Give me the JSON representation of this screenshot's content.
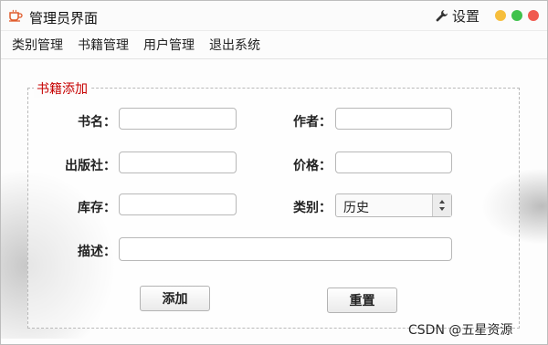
{
  "window": {
    "title": "管理员界面",
    "settings_label": "设置"
  },
  "menu": {
    "items": [
      {
        "label": "类别管理"
      },
      {
        "label": "书籍管理"
      },
      {
        "label": "用户管理"
      },
      {
        "label": "退出系统"
      }
    ]
  },
  "form": {
    "legend": "书籍添加",
    "book_name": {
      "label": "书名：",
      "value": ""
    },
    "author": {
      "label": "作者：",
      "value": ""
    },
    "publisher": {
      "label": "出版社：",
      "value": ""
    },
    "price": {
      "label": "价格：",
      "value": ""
    },
    "stock": {
      "label": "库存：",
      "value": ""
    },
    "category": {
      "label": "类别：",
      "selected": "历史"
    },
    "description": {
      "label": "描述：",
      "value": ""
    },
    "add_label": "添加",
    "reset_label": "重置"
  },
  "watermark": "CSDN @五星资源",
  "colors": {
    "legend": "#c60000",
    "minimize": "#f6be3c",
    "maximize": "#3fc24c",
    "close": "#f05a4f"
  }
}
